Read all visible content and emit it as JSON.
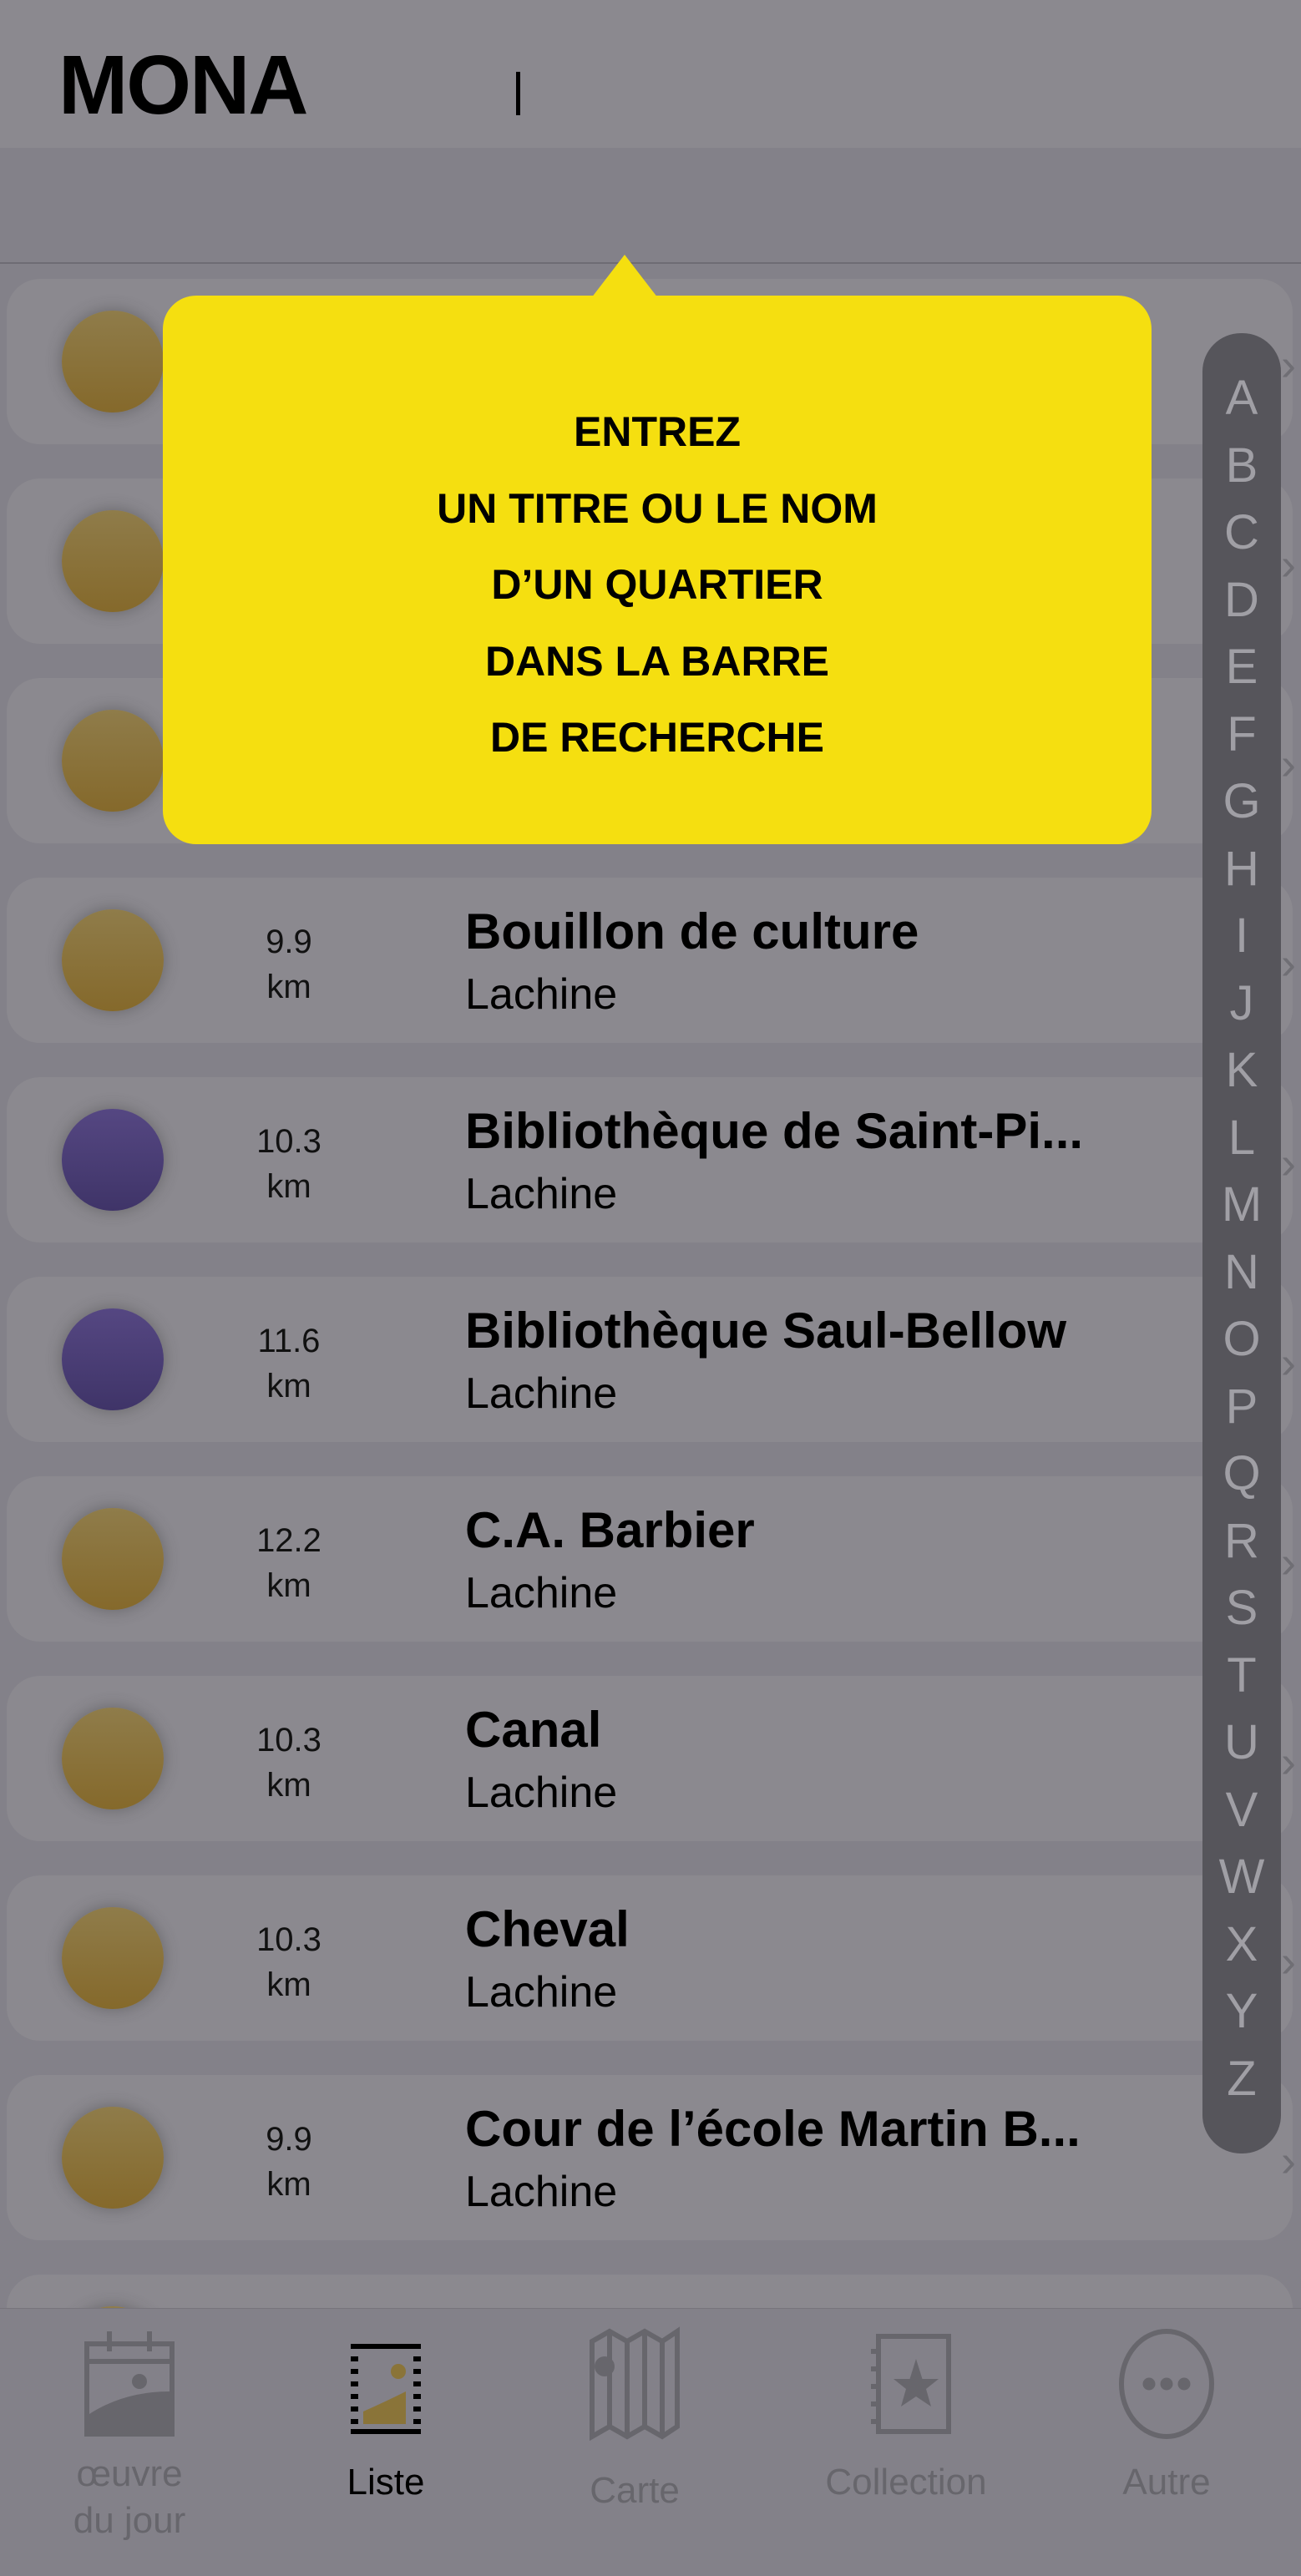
{
  "header": {
    "logo": "MONA"
  },
  "tooltip": {
    "lines": [
      "ENTREZ",
      "UN TITRE OU LE NOM",
      "D’UN QUARTIER",
      "DANS LA BARRE",
      "DE RECHERCHE"
    ]
  },
  "colors": {
    "tooltip": "#f5df10",
    "gold": "#8a7439",
    "purple": "#4a3d74",
    "background": "#838189"
  },
  "list": [
    {
      "color": "gold",
      "distance": "",
      "unit": "",
      "title": "",
      "district": ""
    },
    {
      "color": "gold",
      "distance": "",
      "unit": "",
      "title": "",
      "district": ""
    },
    {
      "color": "gold",
      "distance": "",
      "unit": "",
      "title": "",
      "district": ""
    },
    {
      "color": "gold",
      "distance": "9.9",
      "unit": "km",
      "title": "Bouillon de culture",
      "district": "Lachine"
    },
    {
      "color": "purple",
      "distance": "10.3",
      "unit": "km",
      "title": "Bibliothèque de Saint-Pi...",
      "district": "Lachine"
    },
    {
      "color": "purple",
      "distance": "11.6",
      "unit": "km",
      "title": "Bibliothèque Saul-Bellow",
      "district": "Lachine"
    },
    {
      "color": "gold",
      "distance": "12.2",
      "unit": "km",
      "title": "C.A. Barbier",
      "district": "Lachine"
    },
    {
      "color": "gold",
      "distance": "10.3",
      "unit": "km",
      "title": "Canal",
      "district": "Lachine"
    },
    {
      "color": "gold",
      "distance": "10.3",
      "unit": "km",
      "title": "Cheval",
      "district": "Lachine"
    },
    {
      "color": "gold",
      "distance": "9.9",
      "unit": "km",
      "title": "Cour de l’école Martin B...",
      "district": "Lachine"
    },
    {
      "color": "gold",
      "distance": "",
      "unit": "",
      "title": "",
      "district": ""
    }
  ],
  "index": [
    "A",
    "B",
    "C",
    "D",
    "E",
    "F",
    "G",
    "H",
    "I",
    "J",
    "K",
    "L",
    "M",
    "N",
    "O",
    "P",
    "Q",
    "R",
    "S",
    "T",
    "U",
    "V",
    "W",
    "X",
    "Y",
    "Z"
  ],
  "tabs": [
    {
      "label": "œuvre\ndu jour",
      "icon": "calendar-artwork-icon",
      "active": false
    },
    {
      "label": "Liste",
      "icon": "list-icon",
      "active": true
    },
    {
      "label": "Carte",
      "icon": "map-icon",
      "active": false
    },
    {
      "label": "Collection",
      "icon": "collection-star-icon",
      "active": false
    },
    {
      "label": "Autre",
      "icon": "more-icon",
      "active": false
    }
  ]
}
